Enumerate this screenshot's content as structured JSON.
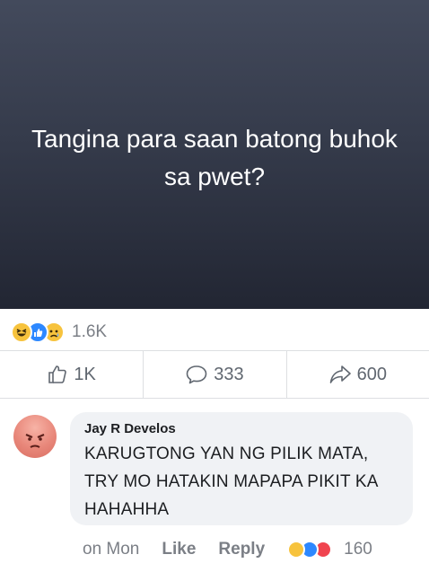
{
  "post": {
    "text": "Tangina para saan batong buhok sa pwet?"
  },
  "reactions": {
    "icons": [
      "haha-icon",
      "like-icon",
      "sad-icon"
    ],
    "count": "1.6K"
  },
  "actions": {
    "like_count": "1K",
    "comment_count": "333",
    "share_count": "600"
  },
  "comment": {
    "author": "Jay R Develos",
    "text": "KARUGTONG YAN NG PILIK MATA, TRY MO HATAKIN MAPAPA PIKIT KA HAHAHHA",
    "time": "on Mon",
    "like_label": "Like",
    "reply_label": "Reply",
    "reaction_icons": [
      "haha-icon",
      "like-icon",
      "angry-icon"
    ],
    "reaction_count": "160"
  },
  "colors": {
    "post_background_top": "#434a5c",
    "post_background_bottom": "#222633",
    "like_blue": "#2d88ff",
    "reaction_yellow": "#f7c33d",
    "muted_text": "#7b7f86"
  }
}
